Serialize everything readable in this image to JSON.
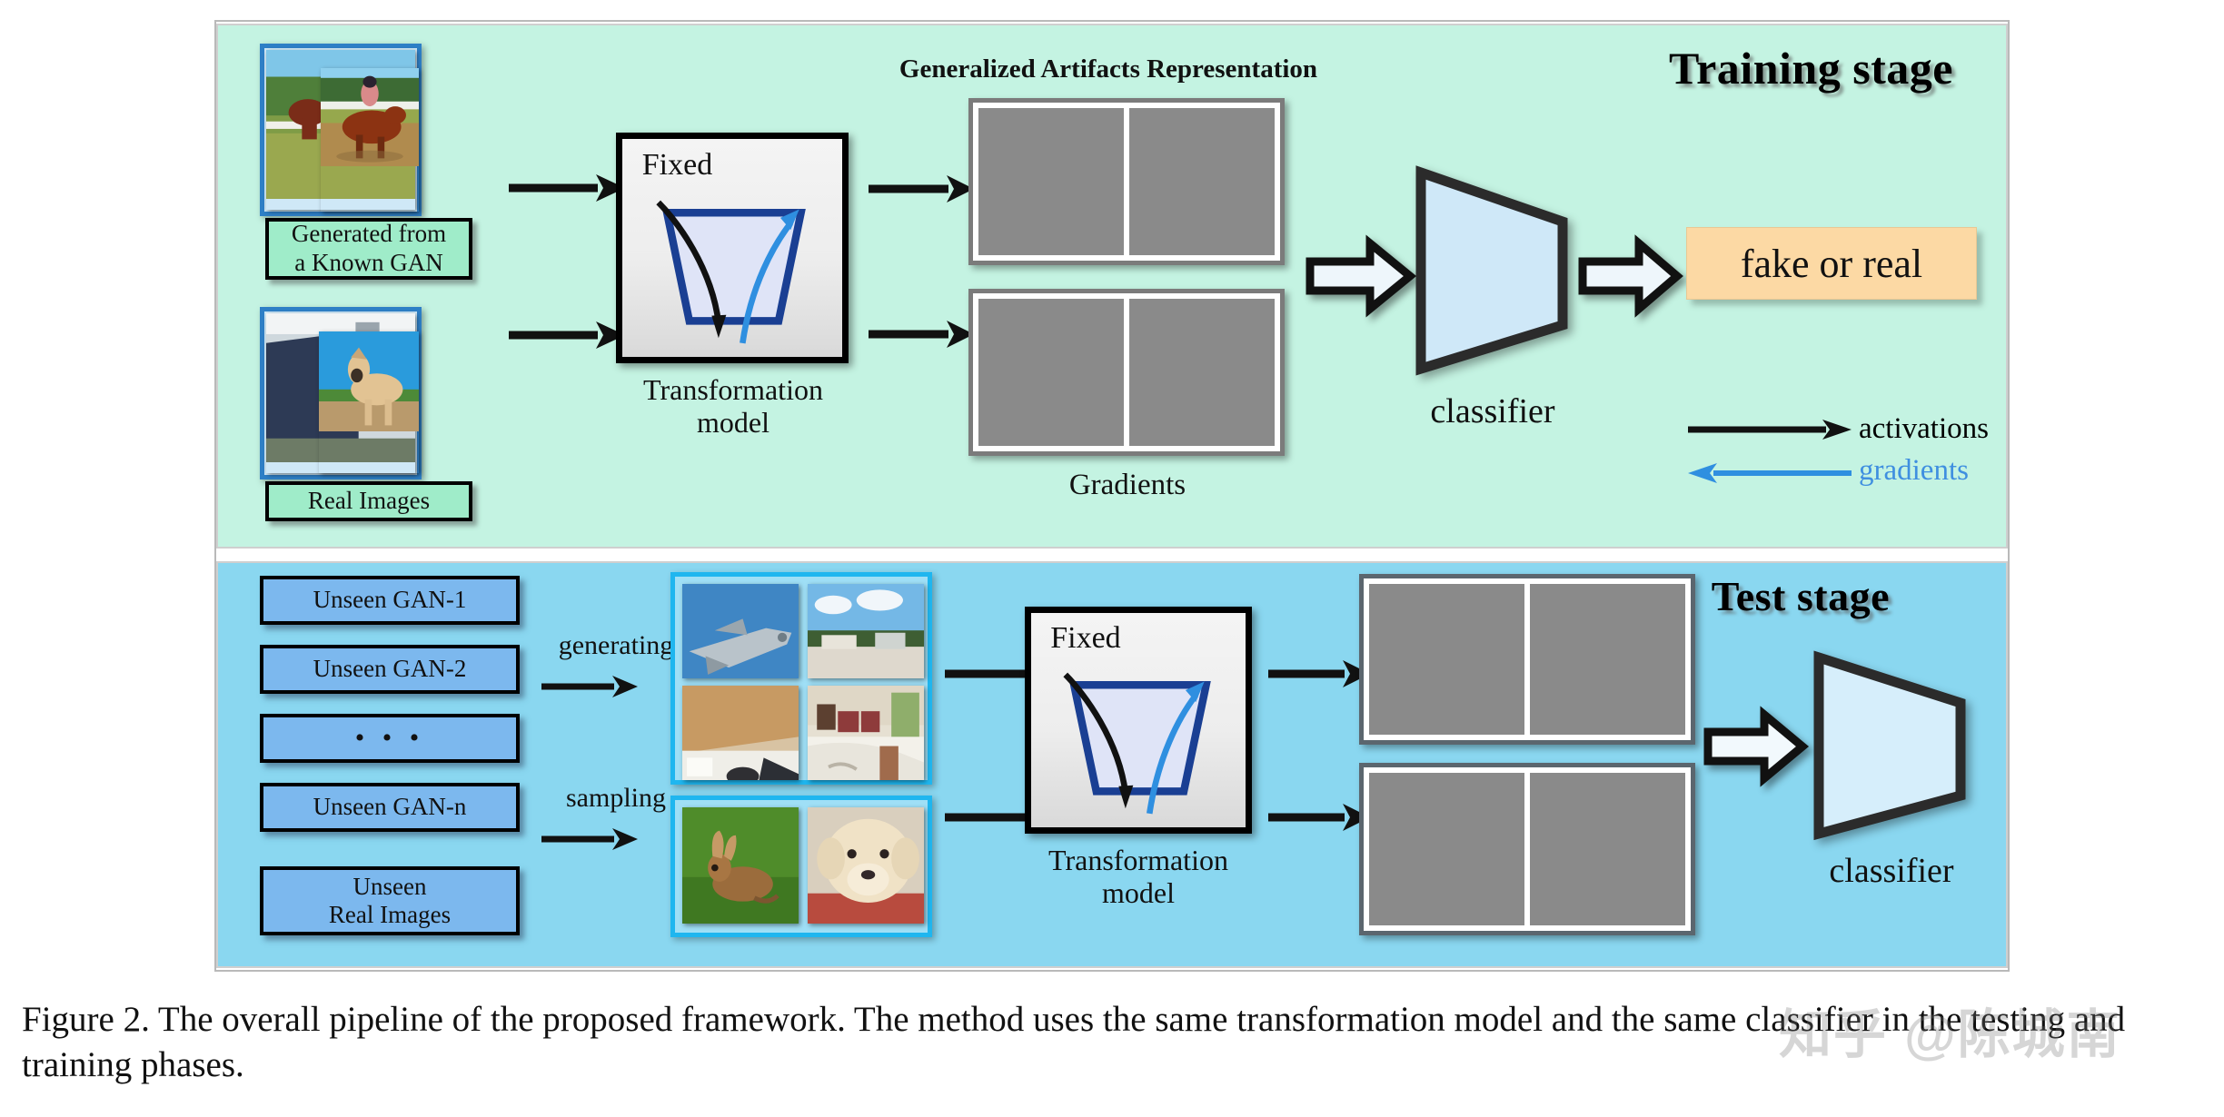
{
  "figure": {
    "caption": "Figure 2. The overall pipeline of the proposed framework. The method uses the same transformation model and the same classifier in the testing and training phases.",
    "watermark": "知乎 @陈城南"
  },
  "training_stage": {
    "title": "Training stage",
    "inputs": [
      {
        "label": "Generated from\na Known GAN",
        "label_line1": "Generated from",
        "label_line2": "a Known GAN"
      },
      {
        "label": "Real Images"
      }
    ],
    "transformation": {
      "inner_label": "Fixed",
      "caption_line1": "Transformation",
      "caption_line2": "model"
    },
    "representation_title": "Generalized Artifacts Representation",
    "gradients_label": "Gradients",
    "classifier_label": "classifier",
    "output_label": "fake or real",
    "legend": [
      {
        "label": "activations",
        "color": "#000000",
        "direction": "right"
      },
      {
        "label": "gradients",
        "color": "#3f8fe0",
        "direction": "left"
      }
    ]
  },
  "test_stage": {
    "title": "Test stage",
    "sources": [
      {
        "label": "Unseen GAN-1"
      },
      {
        "label": "Unseen GAN-2"
      },
      {
        "label": "• • •"
      },
      {
        "label": "Unseen GAN-n"
      },
      {
        "label_line1": "Unseen",
        "label_line2": "Real Images"
      }
    ],
    "flow_labels": [
      {
        "label": "generating"
      },
      {
        "label": "sampling"
      }
    ],
    "transformation": {
      "inner_label": "Fixed",
      "caption_line1": "Transformation",
      "caption_line2": "model"
    },
    "classifier_label": "classifier"
  },
  "colors": {
    "training_bg": "#c4f3e2",
    "test_bg": "#8ad7f0",
    "output_chip": "#fcd9a4",
    "gan_box": "#7cb8ee",
    "label_chip": "#9fecc9",
    "classifier_fill": "#cfe8f8",
    "gradient_blue": "#3f8fe0",
    "funnel_blue": "#1a3f93"
  }
}
